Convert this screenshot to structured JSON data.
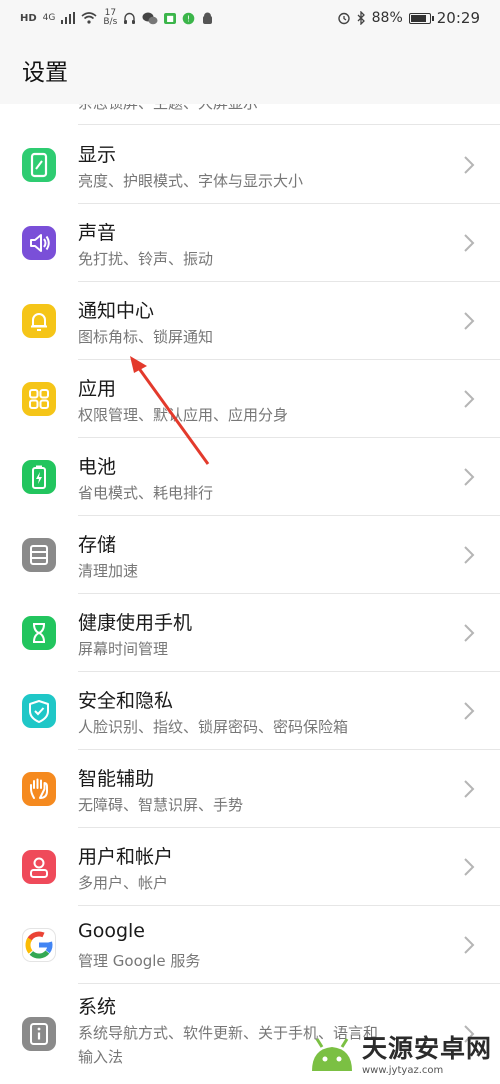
{
  "status_bar": {
    "hd": "HD",
    "network": "4G",
    "speed_value": "17",
    "speed_unit": "B/s",
    "battery_percent": "88%",
    "battery_level": 0.88,
    "time": "20:29"
  },
  "header": {
    "title": "设置"
  },
  "partial_item": {
    "subtitle": "杂志锁屏、主题、大屏显示"
  },
  "items": [
    {
      "title": "显示",
      "subtitle": "亮度、护眼模式、字体与显示大小",
      "icon": "display-icon",
      "color": "#2ecc71"
    },
    {
      "title": "声音",
      "subtitle": "免打扰、铃声、振动",
      "icon": "sound-icon",
      "color": "#7a4fd8"
    },
    {
      "title": "通知中心",
      "subtitle": "图标角标、锁屏通知",
      "icon": "bell-icon",
      "color": "#f5c518"
    },
    {
      "title": "应用",
      "subtitle": "权限管理、默认应用、应用分身",
      "icon": "apps-grid-icon",
      "color": "#f5c518"
    },
    {
      "title": "电池",
      "subtitle": "省电模式、耗电排行",
      "icon": "battery-icon",
      "color": "#22c55e"
    },
    {
      "title": "存储",
      "subtitle": "清理加速",
      "icon": "storage-icon",
      "color": "#8a8a8a"
    },
    {
      "title": "健康使用手机",
      "subtitle": "屏幕时间管理",
      "icon": "hourglass-icon",
      "color": "#22c55e"
    },
    {
      "title": "安全和隐私",
      "subtitle": "人脸识别、指纹、锁屏密码、密码保险箱",
      "icon": "shield-check-icon",
      "color": "#1fc7c7"
    },
    {
      "title": "智能辅助",
      "subtitle": "无障碍、智慧识屏、手势",
      "icon": "hand-icon",
      "color": "#f58a1f"
    },
    {
      "title": "用户和帐户",
      "subtitle": "多用户、帐户",
      "icon": "user-icon",
      "color": "#ef4a5a"
    },
    {
      "title": "Google",
      "subtitle": "管理 Google 服务",
      "icon": "google-icon",
      "color": "#ffffff"
    },
    {
      "title": "系统",
      "subtitle": "系统导航方式、软件更新、关于手机、语言和",
      "subtitle2": "输入法",
      "icon": "info-icon",
      "color": "#8a8a8a"
    }
  ],
  "watermark": {
    "name": "天源安卓网",
    "url": "www.jytyaz.com"
  }
}
